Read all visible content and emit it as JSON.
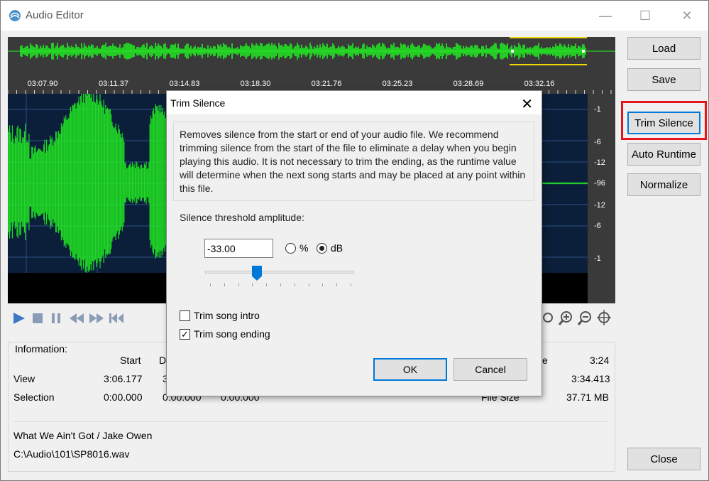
{
  "window": {
    "title": "Audio Editor",
    "minimize_glyph": "—",
    "maximize_glyph": "☐",
    "close_glyph": "✕"
  },
  "side_buttons": {
    "load": "Load",
    "save": "Save",
    "trim_silence": "Trim Silence",
    "auto_runtime": "Auto Runtime",
    "normalize": "Normalize",
    "close": "Close"
  },
  "timeline": {
    "ticks": [
      "03:07.90",
      "03:11.37",
      "03:14.83",
      "03:18.30",
      "03:21.76",
      "03:25.23",
      "03:28.69",
      "03:32.16"
    ]
  },
  "db_scale": {
    "labels": [
      "-1",
      "-6",
      "-12",
      "-96",
      "-12",
      "-6",
      "-1"
    ]
  },
  "info": {
    "heading": "Information:",
    "col_start": "Start",
    "col_duration_partial": "D",
    "row_view": "View",
    "row_selection": "Selection",
    "view_start": "3:06.177",
    "view_partial": "3",
    "selection_start": "0:00.000",
    "selection_duration": "0:00.000",
    "selection_end": "0:00.000",
    "right_label_partial": "e",
    "right_value_1": "3:24",
    "right_value_2": "3:34.413",
    "file_size_label": "File Size",
    "file_size": "37.71 MB",
    "song": "What We Ain't Got / Jake Owen",
    "path": "C:\\Audio\\101\\SP8016.wav"
  },
  "dialog": {
    "title": "Trim Silence",
    "close_glyph": "✕",
    "description": "Removes silence from the start or end of your audio file. We recommend trimming silence from the start of the file to eliminate a delay when you begin playing this audio. It is not necessary to trim the ending, as the runtime value will determine when the next song starts and may be placed at any point within this file.",
    "threshold_label": "Silence threshold amplitude:",
    "threshold_value": "-33.00",
    "unit_percent": "%",
    "unit_db": "dB",
    "selected_unit": "dB",
    "slider_level": 0.33,
    "trim_intro_label": "Trim song intro",
    "trim_intro_checked": false,
    "trim_ending_label": "Trim song ending",
    "trim_ending_checked": true,
    "ok": "OK",
    "cancel": "Cancel"
  },
  "colors": {
    "waveform": "#22ee22",
    "wave_background": "#0b1f3a",
    "highlight": "#e8141b",
    "selection_border": "#f3d700"
  }
}
